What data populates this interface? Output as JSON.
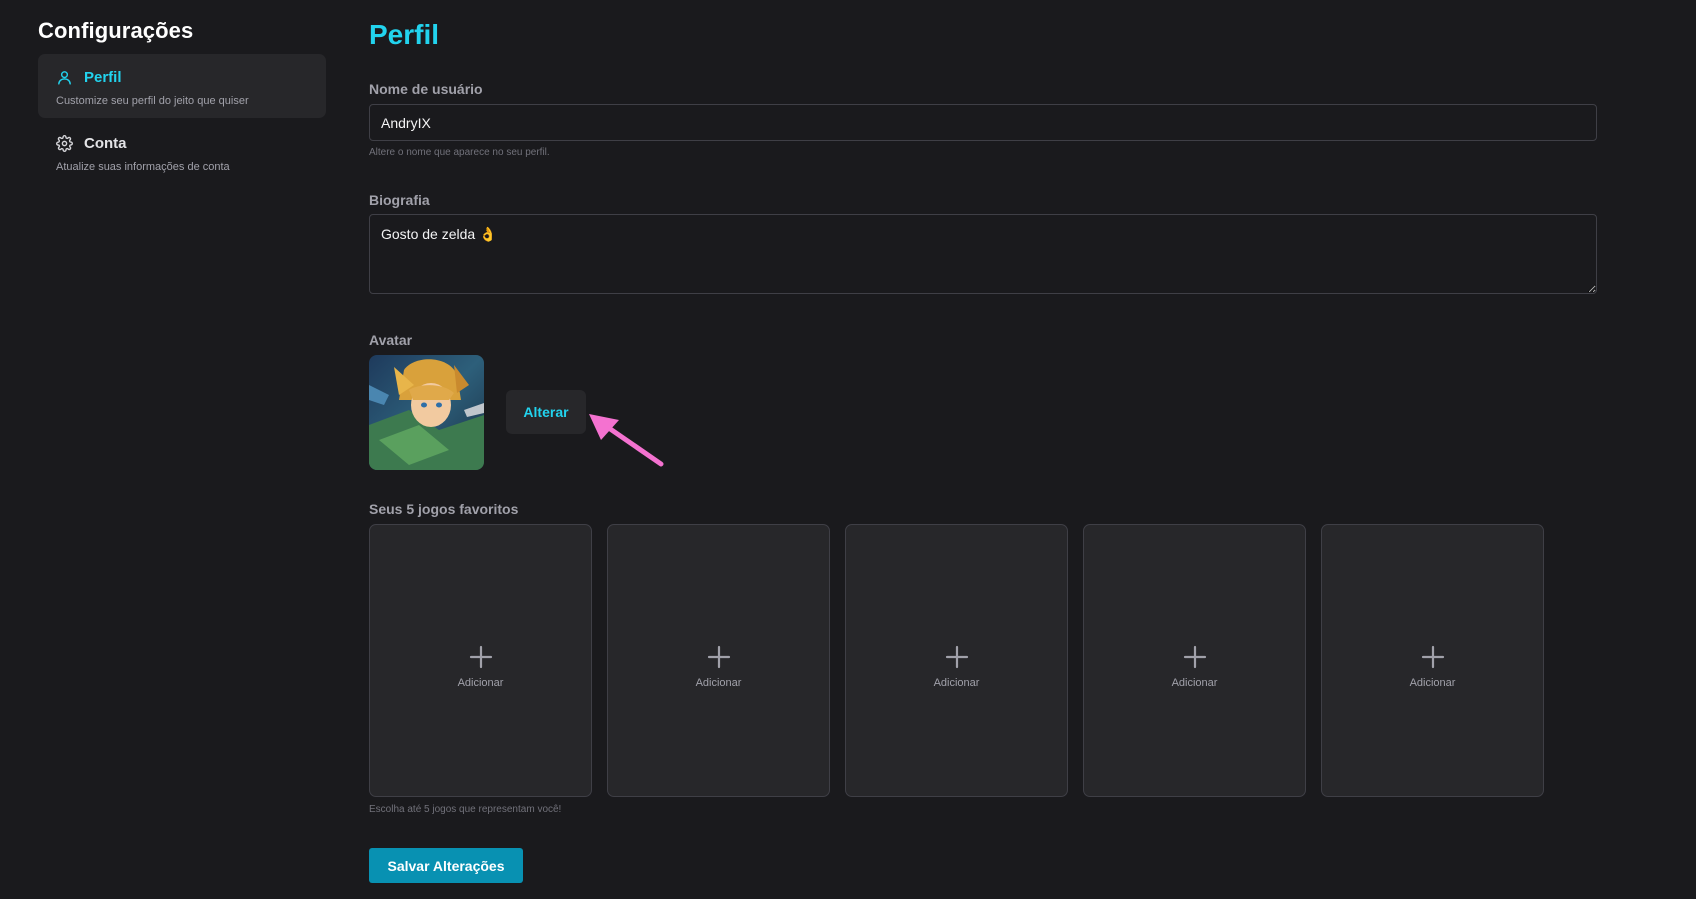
{
  "sidebar": {
    "title": "Configurações",
    "items": [
      {
        "label": "Perfil",
        "description": "Customize seu perfil do jeito que quiser",
        "icon": "user-icon",
        "active": true
      },
      {
        "label": "Conta",
        "description": "Atualize suas informações de conta",
        "icon": "gear-icon",
        "active": false
      }
    ]
  },
  "main": {
    "title": "Perfil",
    "username": {
      "label": "Nome de usuário",
      "value": "AndryIX",
      "hint": "Altere o nome que aparece no seu perfil."
    },
    "bio": {
      "label": "Biografia",
      "value": "Gosto de zelda 👌"
    },
    "avatar": {
      "label": "Avatar",
      "change_label": "Alterar"
    },
    "favorites": {
      "label": "Seus 5 jogos favoritos",
      "slots": [
        {
          "label": "Adicionar"
        },
        {
          "label": "Adicionar"
        },
        {
          "label": "Adicionar"
        },
        {
          "label": "Adicionar"
        },
        {
          "label": "Adicionar"
        }
      ],
      "hint": "Escolha até 5 jogos que representam você!"
    },
    "save_label": "Salvar Alterações"
  },
  "colors": {
    "accent": "#22d3ee",
    "button": "#0891b2",
    "background": "#1a1a1d",
    "surface": "#27272a",
    "annotation_arrow": "#f472d0"
  }
}
